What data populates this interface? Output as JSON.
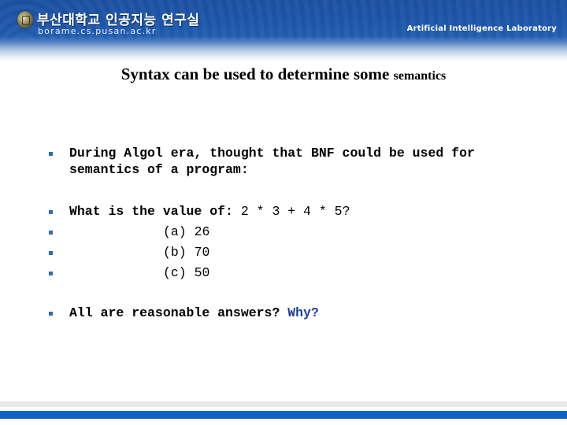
{
  "header": {
    "lab_name_korean": "부산대학교 인공지능 연구실",
    "lab_url": "borame.cs.pusan.ac.kr",
    "lab_name_english": "Artificial Intelligence Laboratory",
    "emblem_icon": "university-seal-icon",
    "brand_color": "#1d55a8"
  },
  "slide": {
    "title_main": "Syntax can be used to determine some ",
    "title_small": "semantics",
    "bullets": [
      {
        "text": "During Algol era, thought that BNF could be used for",
        "continuation": "semantics of a program:"
      },
      {
        "prefix": "What is the value of: ",
        "expression": "2 * 3 + 4 * 5?"
      },
      {
        "text": "(a) 26"
      },
      {
        "text": "(b) 70"
      },
      {
        "text": "(c) 50"
      },
      {
        "prefix": "All are reasonable answers? ",
        "highlight": "Why?"
      }
    ],
    "bullet_color": "#2a6cc0",
    "highlight_color": "#1f3fa0"
  },
  "footer": {
    "bar_gray_color": "#e7e9e8",
    "bar_blue_color": "#0a63c5"
  }
}
